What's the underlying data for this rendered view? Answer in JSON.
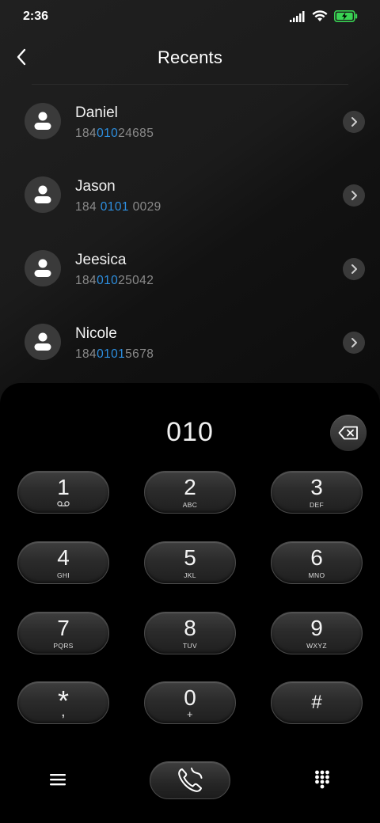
{
  "status_bar": {
    "time": "2:36"
  },
  "header": {
    "title": "Recents"
  },
  "contacts": [
    {
      "name": "Daniel",
      "number_pre": "184",
      "number_hl": "010",
      "number_post": "24685"
    },
    {
      "name": "Jason",
      "number_pre": "184 ",
      "number_hl": "0101",
      "number_post": " 0029"
    },
    {
      "name": "Jeesica",
      "number_pre": "184",
      "number_hl": "010",
      "number_post": "25042"
    },
    {
      "name": "Nicole",
      "number_pre": "184",
      "number_hl": "0101",
      "number_post": "5678"
    }
  ],
  "dialer": {
    "entered_number": "010",
    "keys": [
      {
        "digit": "1",
        "sub": "voicemail-icon"
      },
      {
        "digit": "2",
        "sub": "ABC"
      },
      {
        "digit": "3",
        "sub": "DEF"
      },
      {
        "digit": "4",
        "sub": "GHI"
      },
      {
        "digit": "5",
        "sub": "JKL"
      },
      {
        "digit": "6",
        "sub": "MNO"
      },
      {
        "digit": "7",
        "sub": "PQRS"
      },
      {
        "digit": "8",
        "sub": "TUV"
      },
      {
        "digit": "9",
        "sub": "WXYZ"
      },
      {
        "digit": "*",
        "sub": ","
      },
      {
        "digit": "0",
        "sub": "+"
      },
      {
        "digit": "#",
        "sub": ""
      }
    ]
  },
  "colors": {
    "highlight": "#2d8fe0",
    "background": "#000000",
    "battery": "#39d353"
  }
}
